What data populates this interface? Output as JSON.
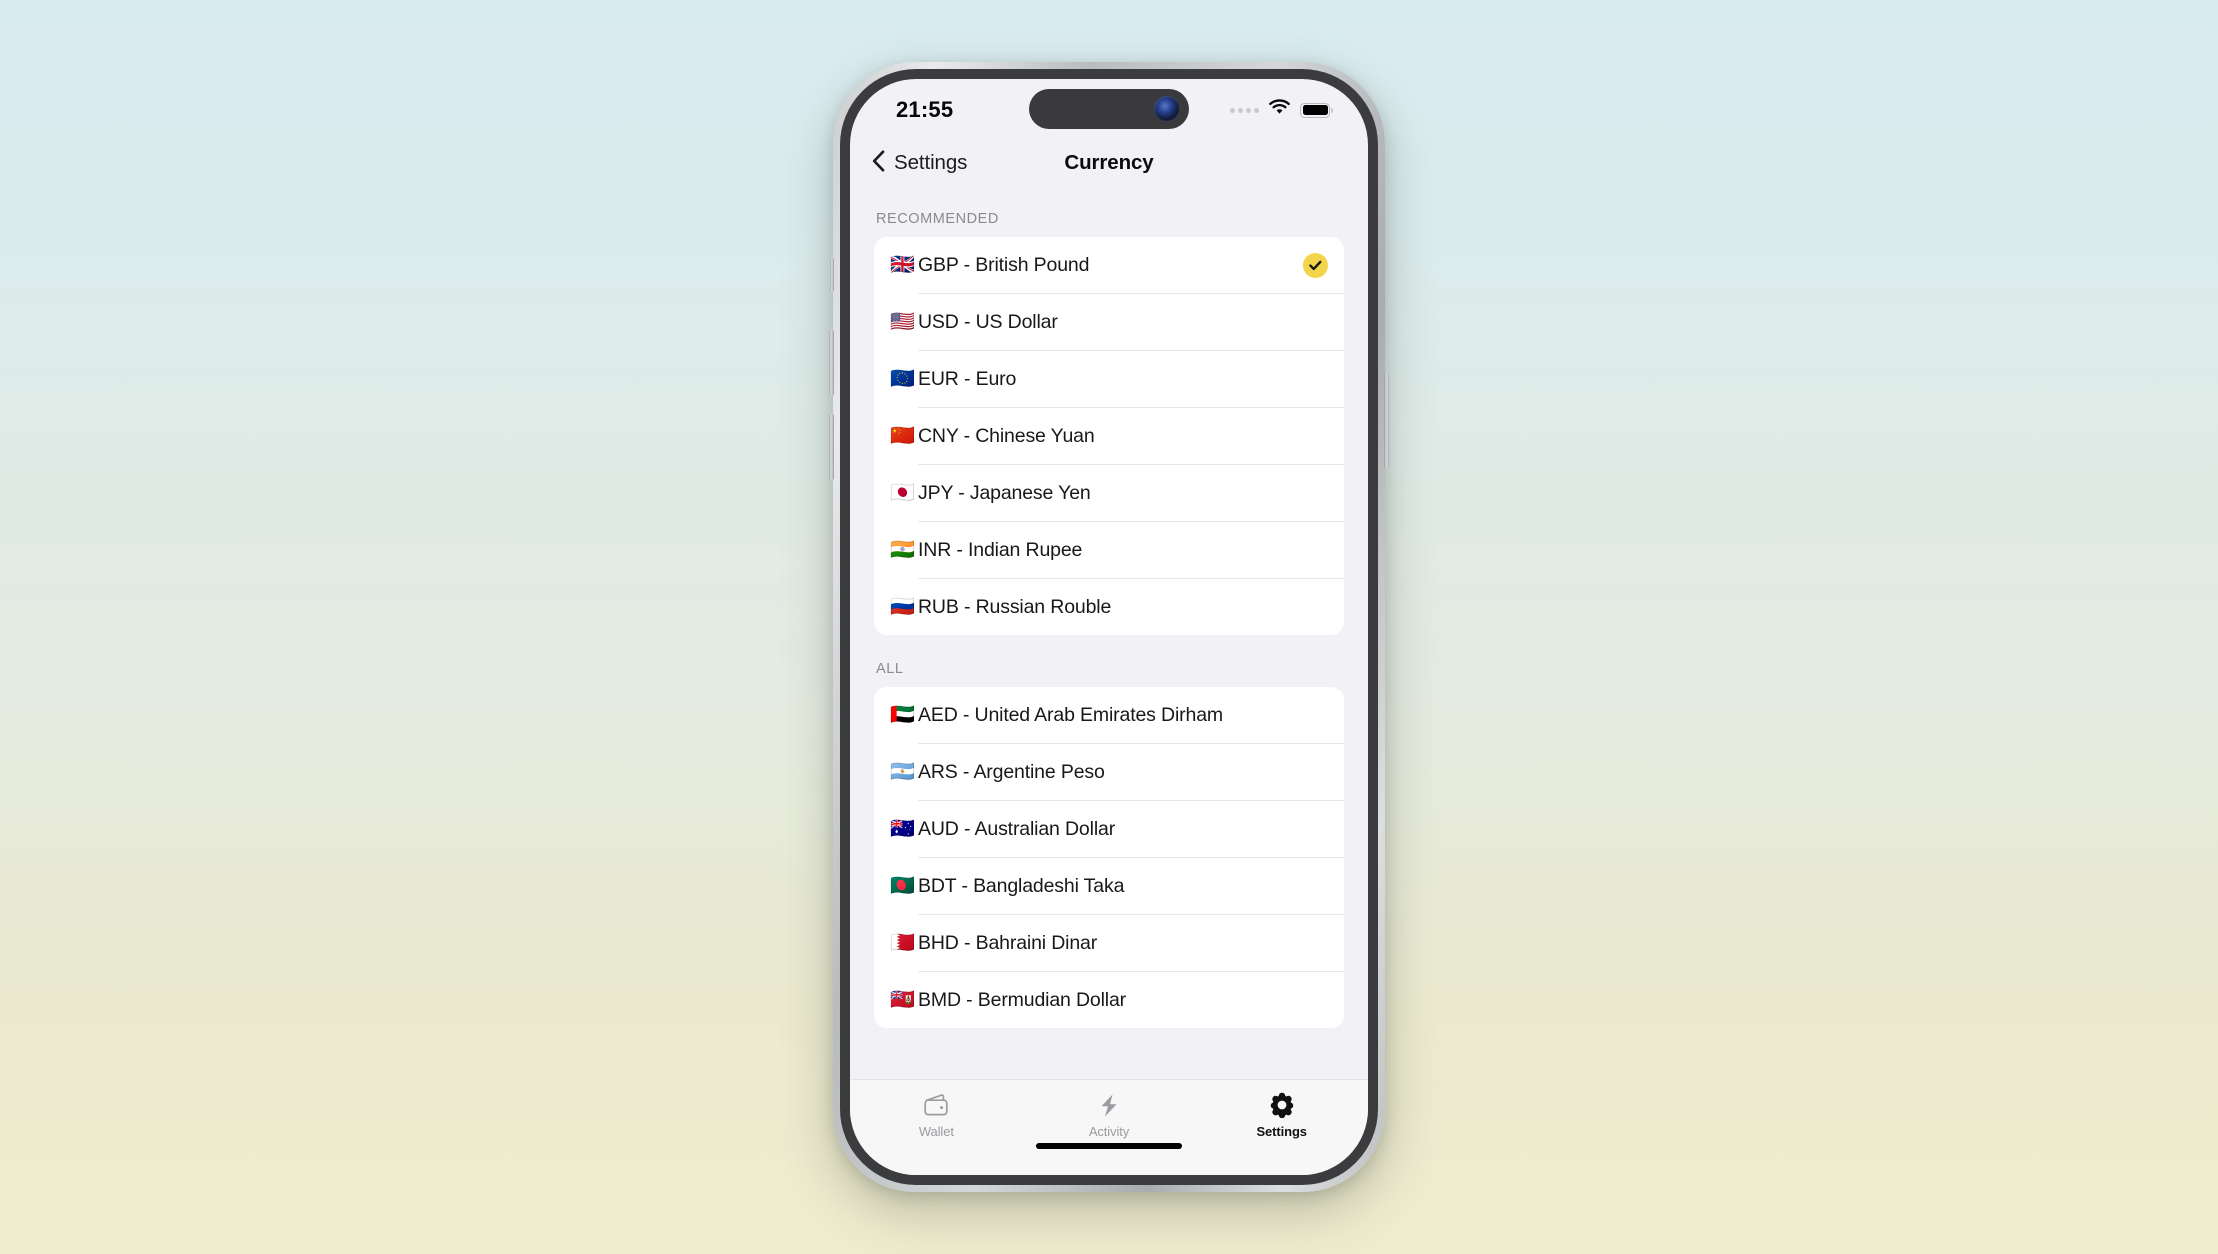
{
  "status_bar": {
    "time": "21:55",
    "signal_icon": "cellular-dots-icon",
    "wifi_icon": "wifi-icon",
    "battery_icon": "battery-full-icon"
  },
  "nav": {
    "back_label": "Settings",
    "back_icon": "chevron-left-icon",
    "title": "Currency"
  },
  "sections": [
    {
      "header": "RECOMMENDED",
      "rows": [
        {
          "flag": "🇬🇧",
          "label": "GBP - British Pound",
          "selected": true
        },
        {
          "flag": "🇺🇸",
          "label": "USD - US Dollar",
          "selected": false
        },
        {
          "flag": "🇪🇺",
          "label": "EUR - Euro",
          "selected": false
        },
        {
          "flag": "🇨🇳",
          "label": "CNY - Chinese Yuan",
          "selected": false
        },
        {
          "flag": "🇯🇵",
          "label": "JPY - Japanese Yen",
          "selected": false
        },
        {
          "flag": "🇮🇳",
          "label": "INR - Indian Rupee",
          "selected": false
        },
        {
          "flag": "🇷🇺",
          "label": "RUB - Russian Rouble",
          "selected": false
        }
      ]
    },
    {
      "header": "ALL",
      "rows": [
        {
          "flag": "🇦🇪",
          "label": "AED - United Arab Emirates Dirham",
          "selected": false
        },
        {
          "flag": "🇦🇷",
          "label": "ARS - Argentine Peso",
          "selected": false
        },
        {
          "flag": "🇦🇺",
          "label": "AUD - Australian Dollar",
          "selected": false
        },
        {
          "flag": "🇧🇩",
          "label": "BDT - Bangladeshi Taka",
          "selected": false
        },
        {
          "flag": "🇧🇭",
          "label": "BHD - Bahraini Dinar",
          "selected": false
        },
        {
          "flag": "🇧🇲",
          "label": "BMD - Bermudian Dollar",
          "selected": false
        }
      ]
    }
  ],
  "tab_bar": {
    "tabs": [
      {
        "label": "Wallet",
        "icon": "wallet-icon",
        "active": false
      },
      {
        "label": "Activity",
        "icon": "lightning-bolt-icon",
        "active": false
      },
      {
        "label": "Settings",
        "icon": "gear-icon",
        "active": true
      }
    ]
  },
  "colors": {
    "accent_selected": "#f3d44a",
    "screen_background": "#f2f1f6",
    "card_background": "#ffffff",
    "tab_active": "#111113",
    "tab_inactive": "#9b9ba0"
  }
}
